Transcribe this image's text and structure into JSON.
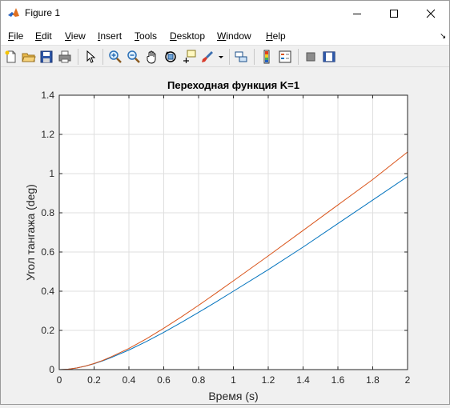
{
  "window": {
    "title": "Figure 1"
  },
  "menu": {
    "items": [
      {
        "label": "File",
        "u": "F",
        "rest": "ile"
      },
      {
        "label": "Edit",
        "u": "E",
        "rest": "dit"
      },
      {
        "label": "View",
        "u": "V",
        "rest": "iew"
      },
      {
        "label": "Insert",
        "u": "I",
        "rest": "nsert"
      },
      {
        "label": "Tools",
        "u": "T",
        "rest": "ools"
      },
      {
        "label": "Desktop",
        "u": "D",
        "rest": "esktop"
      },
      {
        "label": "Window",
        "u": "W",
        "rest": "indow"
      },
      {
        "label": "Help",
        "u": "H",
        "rest": "elp"
      }
    ]
  },
  "toolbar": {
    "icons": [
      "new-figure-icon",
      "open-file-icon",
      "save-icon",
      "print-icon",
      "edit-plot-icon",
      "zoom-in-icon",
      "zoom-out-icon",
      "pan-icon",
      "rotate-3d-icon",
      "data-cursor-icon",
      "brush-icon",
      "brush-dropdown-icon",
      "link-plot-icon",
      "colorbar-icon",
      "legend-icon",
      "hide-plot-tools-icon",
      "show-plot-tools-icon"
    ]
  },
  "colors": {
    "series1": "#0072bd",
    "series2": "#d95319"
  },
  "chart_data": {
    "type": "line",
    "title": "Переходная функция K=1",
    "xlabel": "Время (s)",
    "ylabel": "Угол тангажа (deg)",
    "xlim": [
      0,
      2
    ],
    "ylim": [
      0,
      1.4
    ],
    "xticks": [
      "0",
      "0.2",
      "0.4",
      "0.6",
      "0.8",
      "1",
      "1.2",
      "1.4",
      "1.6",
      "1.8",
      "2"
    ],
    "yticks": [
      "0",
      "0.2",
      "0.4",
      "0.6",
      "0.8",
      "1",
      "1.2",
      "1.4"
    ],
    "grid": true,
    "x": [
      0,
      0.05,
      0.1,
      0.15,
      0.2,
      0.25,
      0.3,
      0.4,
      0.5,
      0.6,
      0.7,
      0.8,
      0.9,
      1.0,
      1.2,
      1.4,
      1.6,
      1.8,
      2.0
    ],
    "series": [
      {
        "values": [
          0,
          0.002,
          0.008,
          0.018,
          0.03,
          0.045,
          0.062,
          0.1,
          0.143,
          0.19,
          0.24,
          0.292,
          0.345,
          0.4,
          0.51,
          0.625,
          0.745,
          0.865,
          0.985
        ]
      },
      {
        "values": [
          0,
          0.002,
          0.008,
          0.018,
          0.031,
          0.047,
          0.066,
          0.108,
          0.157,
          0.211,
          0.268,
          0.328,
          0.39,
          0.453,
          0.58,
          0.71,
          0.84,
          0.97,
          1.11
        ]
      }
    ]
  }
}
